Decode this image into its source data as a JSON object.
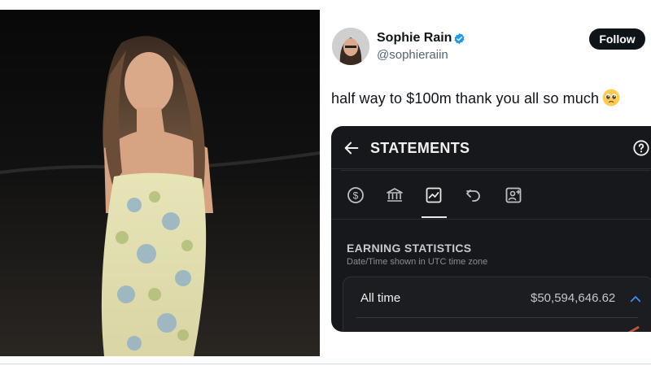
{
  "tweet": {
    "display_name": "Sophie Rain",
    "handle": "@sophieraiin",
    "follow_label": "Follow",
    "text": "half way to $100m thank you all so much"
  },
  "statements": {
    "title": "STATEMENTS",
    "tabs": [
      "dollar-icon",
      "bank-icon",
      "chart-icon",
      "refund-icon",
      "payout-icon"
    ],
    "active_tab": "chart-icon",
    "section_title": "EARNING STATISTICS",
    "section_subtitle": "Date/Time shown in UTC time zone",
    "period_label": "All time",
    "period_amount": "$50,594,646.62"
  },
  "colors": {
    "verified": "#1d9bf0",
    "accent_chevron": "#3d8ef7",
    "dark_bg": "#17181b"
  }
}
